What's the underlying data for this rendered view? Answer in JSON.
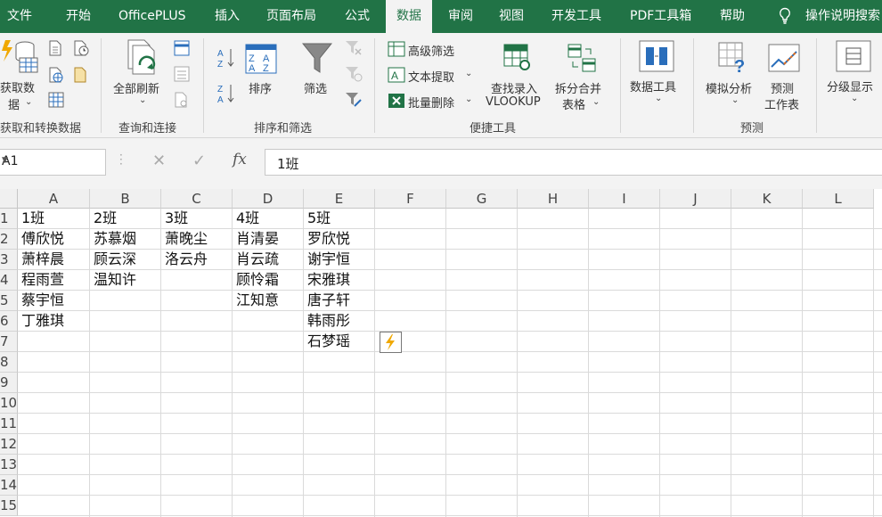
{
  "tabs": [
    "文件",
    "开始",
    "OfficePLUS",
    "插入",
    "页面布局",
    "公式",
    "数据",
    "审阅",
    "视图",
    "开发工具",
    "PDF工具箱",
    "帮助"
  ],
  "active_tab": "数据",
  "tell_me": "操作说明搜索",
  "ribbon": {
    "get_data": {
      "label_line1": "获取数",
      "label_line2": "据",
      "group": "获取和转换数据"
    },
    "refresh_all": {
      "label": "全部刷新",
      "group": "查询和连接"
    },
    "sort": {
      "label": "排序"
    },
    "filter": {
      "label": "筛选",
      "group": "排序和筛选"
    },
    "advanced_filter": "高级筛选",
    "text_extract": "文本提取",
    "batch_delete": "批量删除",
    "lookup_line1": "查找录入",
    "lookup_line2": "VLOOKUP",
    "split_merge_line1": "拆分合并",
    "split_merge_line2": "表格",
    "quick_tools_group": "便捷工具",
    "data_tools": "数据工具",
    "what_if": "模拟分析",
    "forecast_line1": "预测",
    "forecast_line2": "工作表",
    "forecast_group": "预测",
    "outline": "分级显示"
  },
  "formula_bar": {
    "name_box": "A1",
    "fx": "fx",
    "content": "1班"
  },
  "columns": [
    "A",
    "B",
    "C",
    "D",
    "E",
    "F",
    "G",
    "H",
    "I",
    "J",
    "K",
    "L"
  ],
  "rows": [
    "1",
    "2",
    "3",
    "4",
    "5",
    "6",
    "7",
    "8",
    "9",
    "10",
    "11",
    "12",
    "13",
    "14",
    "15"
  ],
  "cells": {
    "A": [
      "1班",
      "傅欣悦",
      "萧梓晨",
      "程雨萱",
      "蔡宇恒",
      "丁雅琪"
    ],
    "B": [
      "2班",
      "苏慕烟",
      "顾云深",
      "温知许"
    ],
    "C": [
      "3班",
      "萧晚尘",
      "洛云舟"
    ],
    "D": [
      "4班",
      "肖清晏",
      "肖云疏",
      "顾怜霜",
      "江知意"
    ],
    "E": [
      "5班",
      "罗欣悦",
      "谢宇恒",
      "宋雅琪",
      "唐子轩",
      "韩雨彤",
      "石梦瑶"
    ]
  },
  "colors": {
    "brand": "#217346",
    "flash_fill": "#f0a800"
  }
}
